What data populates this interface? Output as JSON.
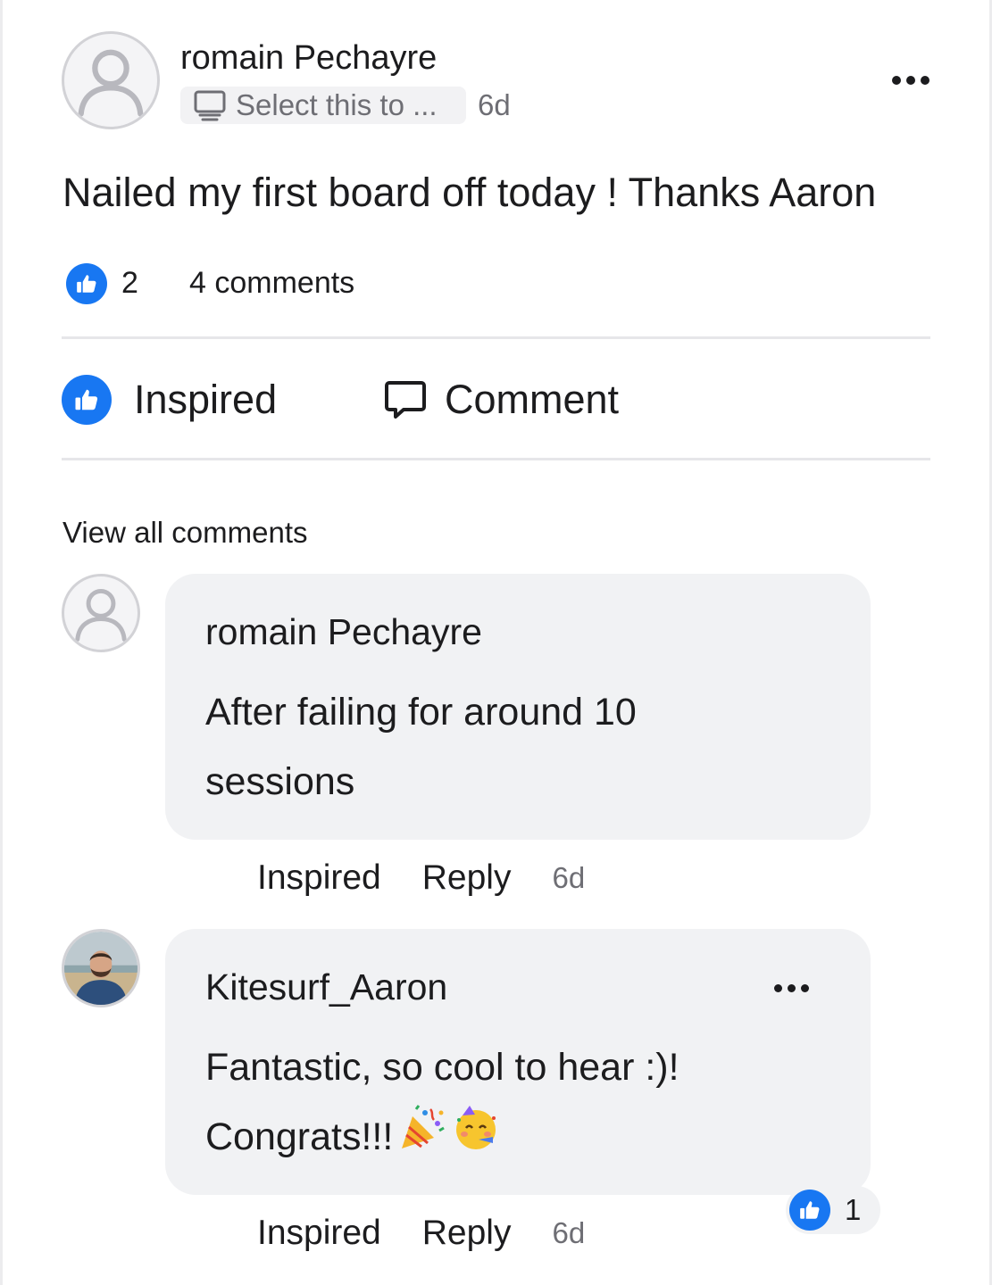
{
  "post": {
    "author": "romain Pechayre",
    "audience_label": "Select this to ...",
    "audience_icon": "computer-icon",
    "time": "6d",
    "text": "Nailed my first board off today ! Thanks Aaron",
    "like_count": "2",
    "comments_count_label": "4 comments"
  },
  "actions": {
    "inspired_label": "Inspired",
    "comment_label": "Comment"
  },
  "view_all_label": "View all comments",
  "comments": [
    {
      "author": "romain Pechayre",
      "text": "After failing for around 10 sessions",
      "inspired_label": "Inspired",
      "reply_label": "Reply",
      "time": "6d"
    },
    {
      "author": "Kitesurf_Aaron",
      "text": "Fantastic, so cool to hear :)! Congrats!!!",
      "emojis": [
        "party-popper-emoji",
        "partying-face-emoji"
      ],
      "inspired_label": "Inspired",
      "reply_label": "Reply",
      "time": "6d",
      "reaction_count": "1"
    }
  ],
  "colors": {
    "accent_blue": "#1877f2",
    "bubble_bg": "#f1f2f4",
    "muted_text": "#6e6e74"
  }
}
